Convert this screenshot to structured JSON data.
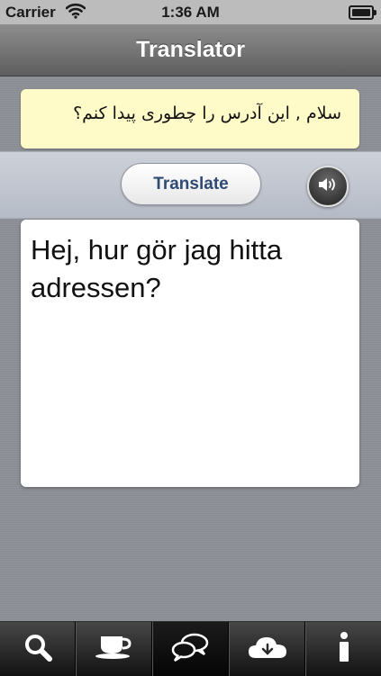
{
  "status_bar": {
    "carrier": "Carrier",
    "time": "1:36 AM",
    "icons": [
      "wifi-icon",
      "battery-icon"
    ]
  },
  "nav_bar": {
    "title": "Translator"
  },
  "source": {
    "text": "سلام , این آدرس را چطوری پیدا کنم؟"
  },
  "toolbar": {
    "translate_label": "Translate",
    "speaker_icon": "speaker-icon"
  },
  "result": {
    "text": "Hej, hur gör jag hitta adressen?"
  },
  "tab_bar": {
    "tabs": [
      {
        "icon": "search-icon",
        "active": false
      },
      {
        "icon": "coffee-cup-icon",
        "active": false
      },
      {
        "icon": "chat-bubbles-icon",
        "active": true
      },
      {
        "icon": "cloud-icon",
        "active": false
      },
      {
        "icon": "info-icon",
        "active": false
      }
    ]
  },
  "colors": {
    "source_background": "#fffbc8",
    "button_text": "#2f4a74",
    "page_background": "#8e9097"
  }
}
